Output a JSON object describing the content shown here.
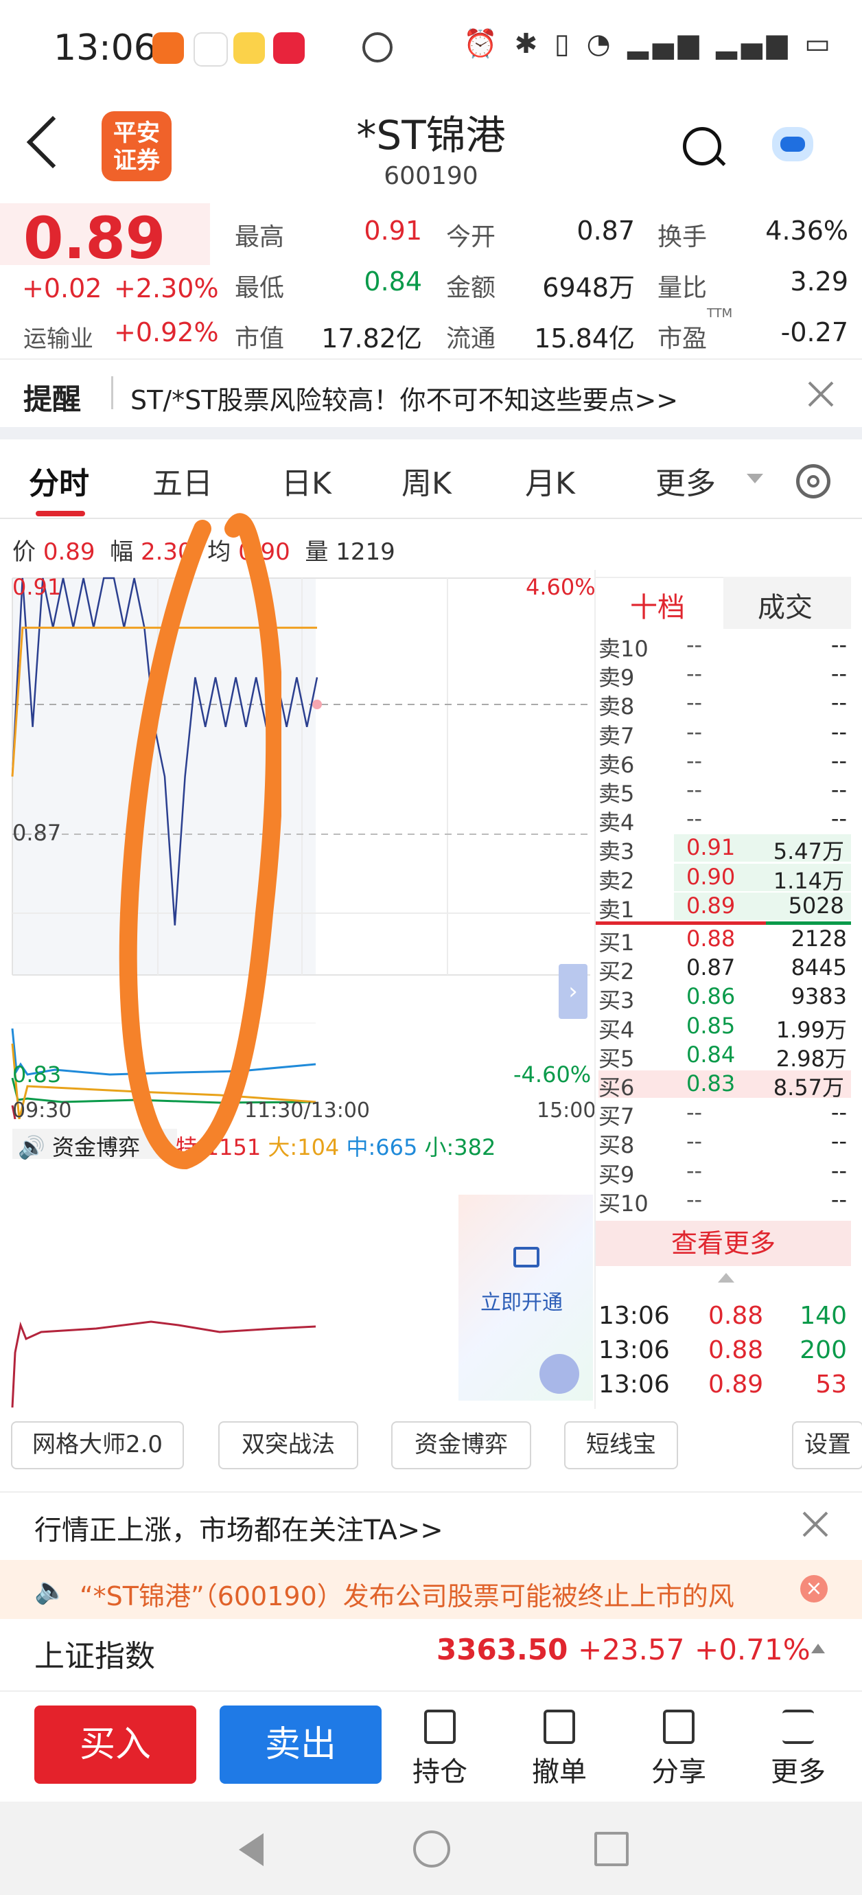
{
  "status_bar": {
    "time": "13:06",
    "right_icons": "⏰ ✱ ▯ ◔ ▂▄▆ ▂▄▆ ▭"
  },
  "header": {
    "title": "*ST锦港",
    "code": "600190",
    "logo_text_1": "平安",
    "logo_text_2": "证券"
  },
  "quote": {
    "price": "0.89",
    "change": "+0.02",
    "change_pct": "+2.30%",
    "sector_label": "运输业",
    "sector_pct": "+0.92%",
    "fields": [
      {
        "label": "最高",
        "value": "0.91"
      },
      {
        "label": "今开",
        "value": "0.87"
      },
      {
        "label": "换手",
        "value": "4.36%"
      },
      {
        "label": "最低",
        "value": "0.84"
      },
      {
        "label": "金额",
        "value": "6948万"
      },
      {
        "label": "量比",
        "value": "3.29"
      },
      {
        "label": "市值",
        "value": "17.82亿"
      },
      {
        "label": "流通",
        "value": "15.84亿"
      },
      {
        "label": "市盈",
        "value": "-0.27"
      }
    ],
    "ttm": "TTM"
  },
  "alert": {
    "title": "提醒",
    "text": "ST/*ST股票风险较高！你不可不知这些要点>>"
  },
  "tabs": [
    "分时",
    "五日",
    "日K",
    "周K",
    "月K",
    "更多"
  ],
  "chart_info": {
    "price_label": "价",
    "price": "0.89",
    "amp_label": "幅",
    "amp": "2.30",
    "avg_label": "均",
    "avg": "0.90",
    "vol_label": "量",
    "vol": "1219"
  },
  "chart_data": {
    "type": "line",
    "y_top": "0.91",
    "y_mid": "0.87",
    "y_bottom": "0.83",
    "pct_top": "4.60%",
    "pct_bottom": "-4.60%",
    "x_labels": [
      "09:30",
      "11:30/13:00",
      "15:00"
    ],
    "ylim": [
      0.83,
      0.91
    ],
    "series": [
      {
        "name": "price",
        "color": "#2b3f8f",
        "values": [
          0.87,
          0.91,
          0.88,
          0.91,
          0.9,
          0.91,
          0.9,
          0.91,
          0.9,
          0.91,
          0.91,
          0.9,
          0.91,
          0.9,
          0.88,
          0.87,
          0.84,
          0.87,
          0.89,
          0.88,
          0.89,
          0.88,
          0.89,
          0.88,
          0.89,
          0.88,
          0.89,
          0.88,
          0.89,
          0.88,
          0.89
        ]
      },
      {
        "name": "avg",
        "color": "#f0a020",
        "values": [
          0.87,
          0.9,
          0.9,
          0.9,
          0.9,
          0.9,
          0.9,
          0.9,
          0.9,
          0.9,
          0.9,
          0.9,
          0.9,
          0.9,
          0.9,
          0.9,
          0.9,
          0.9,
          0.9,
          0.9,
          0.9,
          0.9,
          0.9,
          0.9,
          0.9,
          0.9,
          0.9,
          0.9,
          0.9,
          0.9,
          0.9
        ]
      }
    ]
  },
  "fund_game": {
    "label": "资金博弈",
    "te_label": "特",
    "te": ":1151",
    "da_label": "大",
    "da": ":104",
    "zhong_label": "中",
    "zhong": ":665",
    "xiao_label": "小",
    "xiao": ":382",
    "unlock": "立即开通"
  },
  "order_book": {
    "tabs": [
      "十档",
      "成交"
    ],
    "asks": [
      {
        "label": "卖10",
        "price": "--",
        "vol": "--"
      },
      {
        "label": "卖9",
        "price": "--",
        "vol": "--"
      },
      {
        "label": "卖8",
        "price": "--",
        "vol": "--"
      },
      {
        "label": "卖7",
        "price": "--",
        "vol": "--"
      },
      {
        "label": "卖6",
        "price": "--",
        "vol": "--"
      },
      {
        "label": "卖5",
        "price": "--",
        "vol": "--"
      },
      {
        "label": "卖4",
        "price": "--",
        "vol": "--"
      },
      {
        "label": "卖3",
        "price": "0.91",
        "vol": "5.47万"
      },
      {
        "label": "卖2",
        "price": "0.90",
        "vol": "1.14万"
      },
      {
        "label": "卖1",
        "price": "0.89",
        "vol": "5028"
      }
    ],
    "bids": [
      {
        "label": "买1",
        "price": "0.88",
        "vol": "2128"
      },
      {
        "label": "买2",
        "price": "0.87",
        "vol": "8445"
      },
      {
        "label": "买3",
        "price": "0.86",
        "vol": "9383"
      },
      {
        "label": "买4",
        "price": "0.85",
        "vol": "1.99万"
      },
      {
        "label": "买5",
        "price": "0.84",
        "vol": "2.98万"
      },
      {
        "label": "买6",
        "price": "0.83",
        "vol": "8.57万"
      },
      {
        "label": "买7",
        "price": "--",
        "vol": "--"
      },
      {
        "label": "买8",
        "price": "--",
        "vol": "--"
      },
      {
        "label": "买9",
        "price": "--",
        "vol": "--"
      },
      {
        "label": "买10",
        "price": "--",
        "vol": "--"
      }
    ],
    "more": "查看更多",
    "trades": [
      {
        "time": "13:06",
        "price": "0.88",
        "vol": "140"
      },
      {
        "time": "13:06",
        "price": "0.88",
        "vol": "200"
      },
      {
        "time": "13:06",
        "price": "0.89",
        "vol": "53"
      }
    ]
  },
  "toolbar_chips": [
    "网格大师2.0",
    "双突战法",
    "资金博弈",
    "短线宝",
    "设置"
  ],
  "notice1": "行情正上涨，市场都在关注TA>>",
  "notice2": "“*ST锦港”（600190）发布公司股票可能被终止上市的风",
  "index": {
    "name": "上证指数",
    "value": "3363.50",
    "change": "+23.57",
    "pct": "+0.71%"
  },
  "bottom": {
    "buy": "买入",
    "sell": "卖出",
    "tools": [
      "持仓",
      "撤单",
      "分享",
      "更多"
    ]
  },
  "colors": {
    "up": "#e0262f",
    "down": "#0a9a4a",
    "price_line": "#2b3f8f",
    "avg_line": "#f0a020",
    "annotation": "#f5822a"
  }
}
